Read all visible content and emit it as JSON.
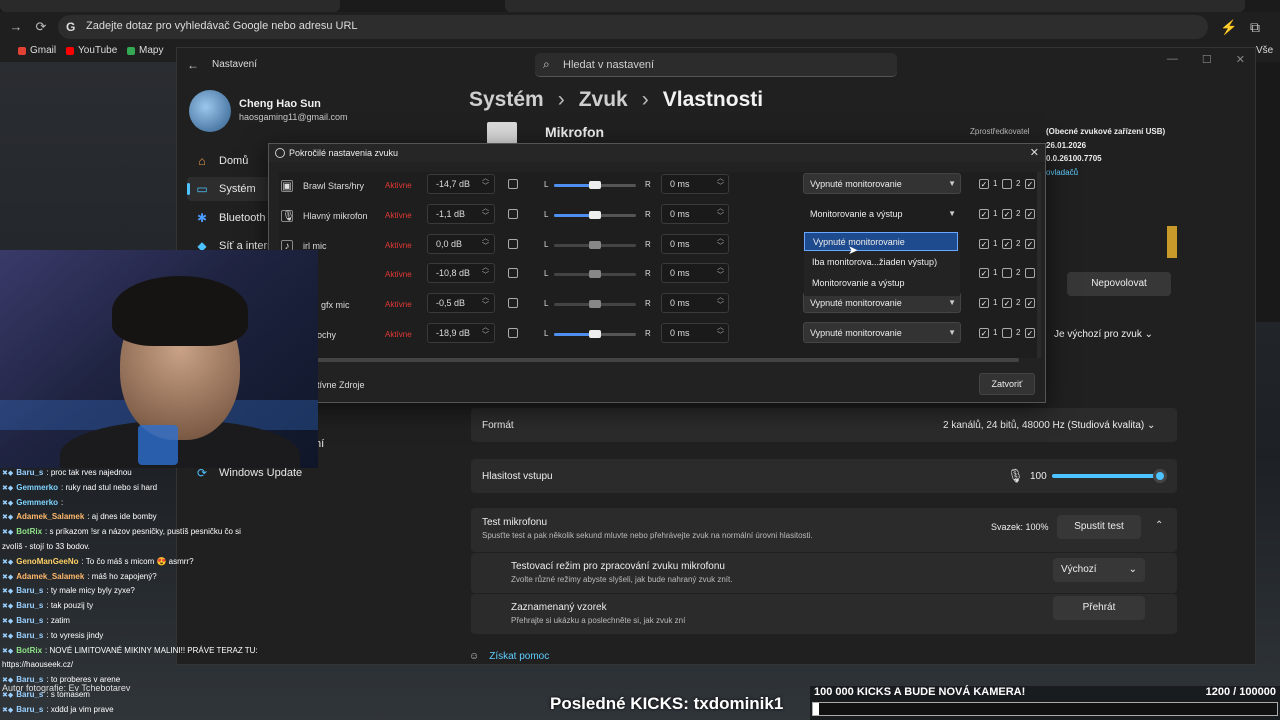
{
  "browser": {
    "address_text": "Zadejte dotaz pro vyhledávač Google nebo adresu URL",
    "bookmarks": [
      "Gmail",
      "YouTube",
      "Mapy"
    ],
    "bookmark_overflow": "Vše"
  },
  "settings": {
    "app_title": "Nastavení",
    "search_placeholder": "Hledat v nastavení",
    "user_name": "Cheng Hao Sun",
    "user_email": "haosgaming11@gmail.com",
    "nav": [
      "Domů",
      "Systém",
      "Bluetooth a",
      "Síť a interne",
      "Windows Update"
    ],
    "nav_partial": "ní",
    "breadcrumb": [
      "Systém",
      "Zvuk",
      "Vlastnosti"
    ],
    "device_name": "Mikrofon",
    "provider_label": "Zprostředkovatel",
    "provider_value": "(Obecné zvukové zařízení USB)",
    "date_value": "26.01.2026",
    "version_value": "0.0.26100.7705",
    "driver_link": "ovladačů",
    "disallow_button": "Nepovolovat",
    "default_dropdown": "Je výchozí pro zvuk",
    "format_label": "Formát",
    "format_value": "2 kanálů, 24 bitů, 48000 Hz (Studiová kvalita)",
    "input_volume_label": "Hlasitost vstupu",
    "input_volume_value": "100",
    "input_volume_level": 1.0,
    "test_title": "Test mikrofonu",
    "test_sub": "Spusťte test a pak několik sekund mluvte nebo přehrávejte zvuk na normální úrovni hlasitosti.",
    "test_volume": "Svazek: 100%",
    "test_button": "Spustit test",
    "test_mode_title": "Testovací režim pro zpracování zvuku mikrofonu",
    "test_mode_sub": "Zvolte různé režimy abyste slyšeli, jak bude nahraný zvuk znít.",
    "test_mode_value": "Výchozí",
    "recorded_title": "Zaznamenaný vzorek",
    "recorded_sub": "Přehrajte si ukázku a poslechněte si, jak zvuk zní",
    "play_button": "Přehrát",
    "help_link": "Získat pomoc"
  },
  "dialog": {
    "title": "Pokročilé nastavenia zvuku",
    "close_button": "Zatvoriť",
    "footer_label": "tívne Zdroje",
    "rows": [
      {
        "name": "Brawl Stars/hry",
        "status": "Aktívne",
        "db": "-14,7 dB",
        "pan": 0.5,
        "pan_active": true,
        "delay": "0 ms",
        "monitor": "Vypnuté monitorovanie",
        "dropdown": true,
        "c1": true,
        "c2": false,
        "c3": true
      },
      {
        "name": "Hlavný mikrofon",
        "status": "Aktívne",
        "db": "-1,1 dB",
        "pan": 0.5,
        "pan_active": true,
        "delay": "0 ms",
        "monitor": "Monitorovanie a výstup",
        "dropdown": false,
        "c1": true,
        "c2": true,
        "c3": true
      },
      {
        "name": "irl mic",
        "status": "Aktívne",
        "db": "0,0 dB",
        "pan": 0.5,
        "pan_active": false,
        "delay": "0 ms",
        "monitor": "",
        "dropdown": false,
        "c1": true,
        "c2": true,
        "c3": true
      },
      {
        "name": "AM",
        "status": "Aktívne",
        "db": "-10,8 dB",
        "pan": 0.5,
        "pan_active": false,
        "delay": "0 ms",
        "monitor": "",
        "dropdown": false,
        "c1": true,
        "c2": false,
        "c3": false
      },
      {
        "name": "lajsi gfx mic",
        "status": "Aktívne",
        "db": "-0,5 dB",
        "pan": 0.5,
        "pan_active": false,
        "delay": "0 ms",
        "monitor": "Vypnuté monitorovanie",
        "dropdown": true,
        "c1": true,
        "c2": true,
        "c3": true
      },
      {
        "name": "k plochy",
        "status": "Aktívne",
        "db": "-18,9 dB",
        "pan": 0.5,
        "pan_active": true,
        "delay": "0 ms",
        "monitor": "Vypnuté monitorovanie",
        "dropdown": true,
        "c1": true,
        "c2": false,
        "c3": true
      }
    ],
    "popup_options": [
      "Vypnuté monitorovanie",
      "Iba monitorova...žiaden výstup)",
      "Monitorovanie a výstup"
    ],
    "popup_selected": 0
  },
  "chat": [
    {
      "user": "Baru_s",
      "text": ": proc tak rves najednou",
      "color": "#9ad0ff"
    },
    {
      "user": "Gemmerko",
      "text": ": ruky nad stul nebo si hard",
      "color": "#7fd3ff"
    },
    {
      "user": "Gemmerko",
      "text": ":",
      "color": "#7fd3ff"
    },
    {
      "user": "Adamek_Salamek",
      "text": ": aj dnes ide bomby",
      "color": "#ffb86b"
    },
    {
      "user": "BotRix",
      "text": ": s príkazom !sr a názov pesničky, pustíš pesničku čo si",
      "color": "#8fe388"
    },
    {
      "user": "",
      "text": "zvolíš - stojí to 33 bodov.",
      "color": "#fff"
    },
    {
      "user": "GenoManGeeNo",
      "text": ": To čo máš s micom 😍 asmrr?",
      "color": "#ffd166"
    },
    {
      "user": "Adamek_Salamek",
      "text": ": máš ho zapojený?",
      "color": "#ffb86b"
    },
    {
      "user": "Baru_s",
      "text": ": ty male micy byly zyxe?",
      "color": "#9ad0ff"
    },
    {
      "user": "Baru_s",
      "text": ": tak pouzij ty",
      "color": "#9ad0ff"
    },
    {
      "user": "Baru_s",
      "text": ": zatim",
      "color": "#9ad0ff"
    },
    {
      "user": "Baru_s",
      "text": ": to vyresis jindy",
      "color": "#9ad0ff"
    },
    {
      "user": "BotRix",
      "text": ": NOVÉ LIMITOVANÉ MIKINY MALINI!! PRÁVE TERAZ TU:",
      "color": "#8fe388"
    },
    {
      "user": "",
      "text": "https://haouseek.cz/",
      "color": "#fff"
    },
    {
      "user": "Baru_s",
      "text": ": to proberes v arene",
      "color": "#9ad0ff"
    },
    {
      "user": "Baru_s",
      "text": ": s tomasem",
      "color": "#9ad0ff"
    },
    {
      "user": "Baru_s",
      "text": ": xddd ja vim prave",
      "color": "#9ad0ff"
    }
  ],
  "overlay": {
    "photo_credit": "Autor fotografie: Ev Tchebotarev",
    "last_kicks": "Posledné KICKS: txdominik1",
    "goal_title": "100 000 KICKS A BUDE NOVÁ KAMERA!",
    "goal_count": "1200 / 100000",
    "goal_fraction": 0.012
  }
}
